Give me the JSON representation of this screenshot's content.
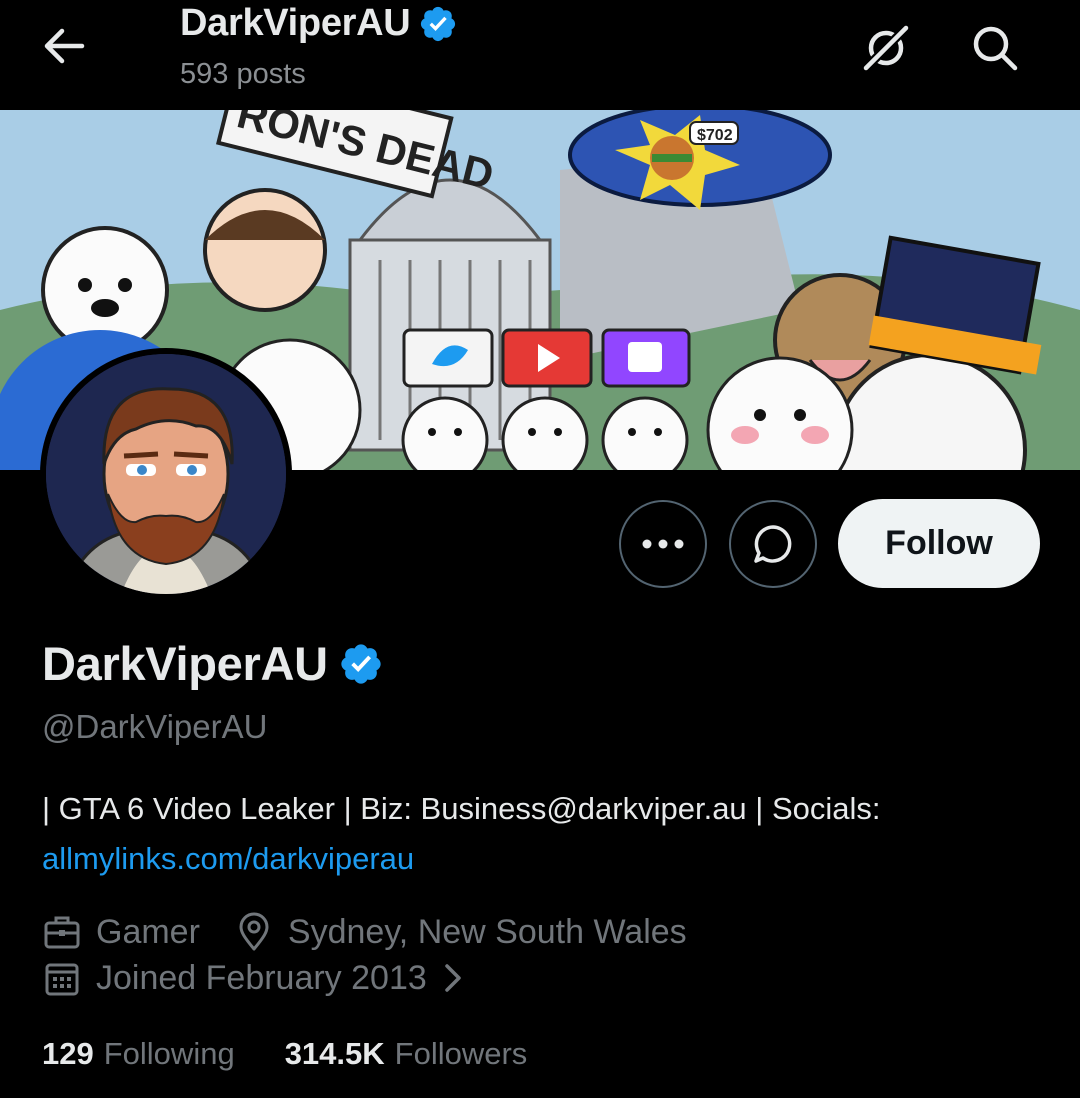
{
  "header": {
    "name": "DarkViperAU",
    "posts": "593 posts",
    "back_icon": "arrow-left-icon",
    "grok_icon": "grok-icon",
    "search_icon": "search-icon"
  },
  "banner": {
    "sign_text": "RON'S DEAD",
    "price_tag": "$702"
  },
  "actions": {
    "follow_label": "Follow",
    "more_icon": "more-icon",
    "grok_chat_icon": "grok-chat-icon"
  },
  "profile": {
    "display_name": "DarkViperAU",
    "handle": "@DarkViperAU",
    "bio_text": "| GTA 6 Video Leaker | Biz: Business@darkviper.au | Socials:",
    "bio_link": "allmylinks.com/darkviperau",
    "category": "Gamer",
    "location": "Sydney, New South Wales",
    "joined": "Joined February 2013",
    "following_count": "129",
    "following_label": "Following",
    "followers_count": "314.5K",
    "followers_label": "Followers"
  },
  "colors": {
    "accent": "#1d9bf0",
    "background": "#000000",
    "muted": "#71767b",
    "verified": "#1d9bf0"
  }
}
